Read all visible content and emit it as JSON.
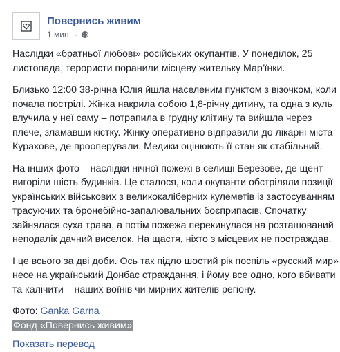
{
  "post": {
    "page_name": "Повернись живим",
    "timestamp": "1 мин.",
    "separator": "·",
    "paragraphs": [
      "Наслідки «братньої любові» російських окупантів. У понеділок, 25 листопада, терористи поранили місцеву жительку Мар'їнки.",
      "Близько 12:00 38-річна Юлія йшла населеним пунктом з візочком, коли почала пострілі. Жінка накрила собою 1,8-річну дитину, та одна з куль влучила у неї саму – потрапила в грудну клітину та вийшла через плече, зламавши кістку. Жінку оперативно відправили до лікарні міста Курахове, де прооперували. Медики оцінюють її стан як стабільний.",
      "На інших фото – наслідки нічної пожежі в селищі Березове, де щент вигоріли шість будинків. Це сталося, коли окупанти обстріляли позиції українських військових з великокаліберних кулеметів із застосуванням трасуючих та бронебійно-запалювальних боєприпасів. Спочатку зайнялася суха трава, а потім пожежа перекинулася на розташований неподалік дачний виселок. На щастя, ніхто з місцевих не постраждав.",
      "І це всього за дві доби. Ось так підло шостий рік поспіль «русский мир» несе на український Донбас страждання, і йому все одно, кого вбивати та калічити – наших воїнів чи мирних жителів регіону."
    ],
    "photo_label": "Фото: ",
    "photo_author": "Ganka Garna",
    "highlighted_text": "Фонд «Повернись живим»",
    "translate_link": "Показать перевод"
  },
  "icons": {
    "avatar": "heart-shield-logo",
    "privacy": "globe-icon"
  },
  "colors": {
    "link": "#385898",
    "text": "#1d2129",
    "meta": "#606770",
    "highlight_bg": "#8a8d91"
  }
}
